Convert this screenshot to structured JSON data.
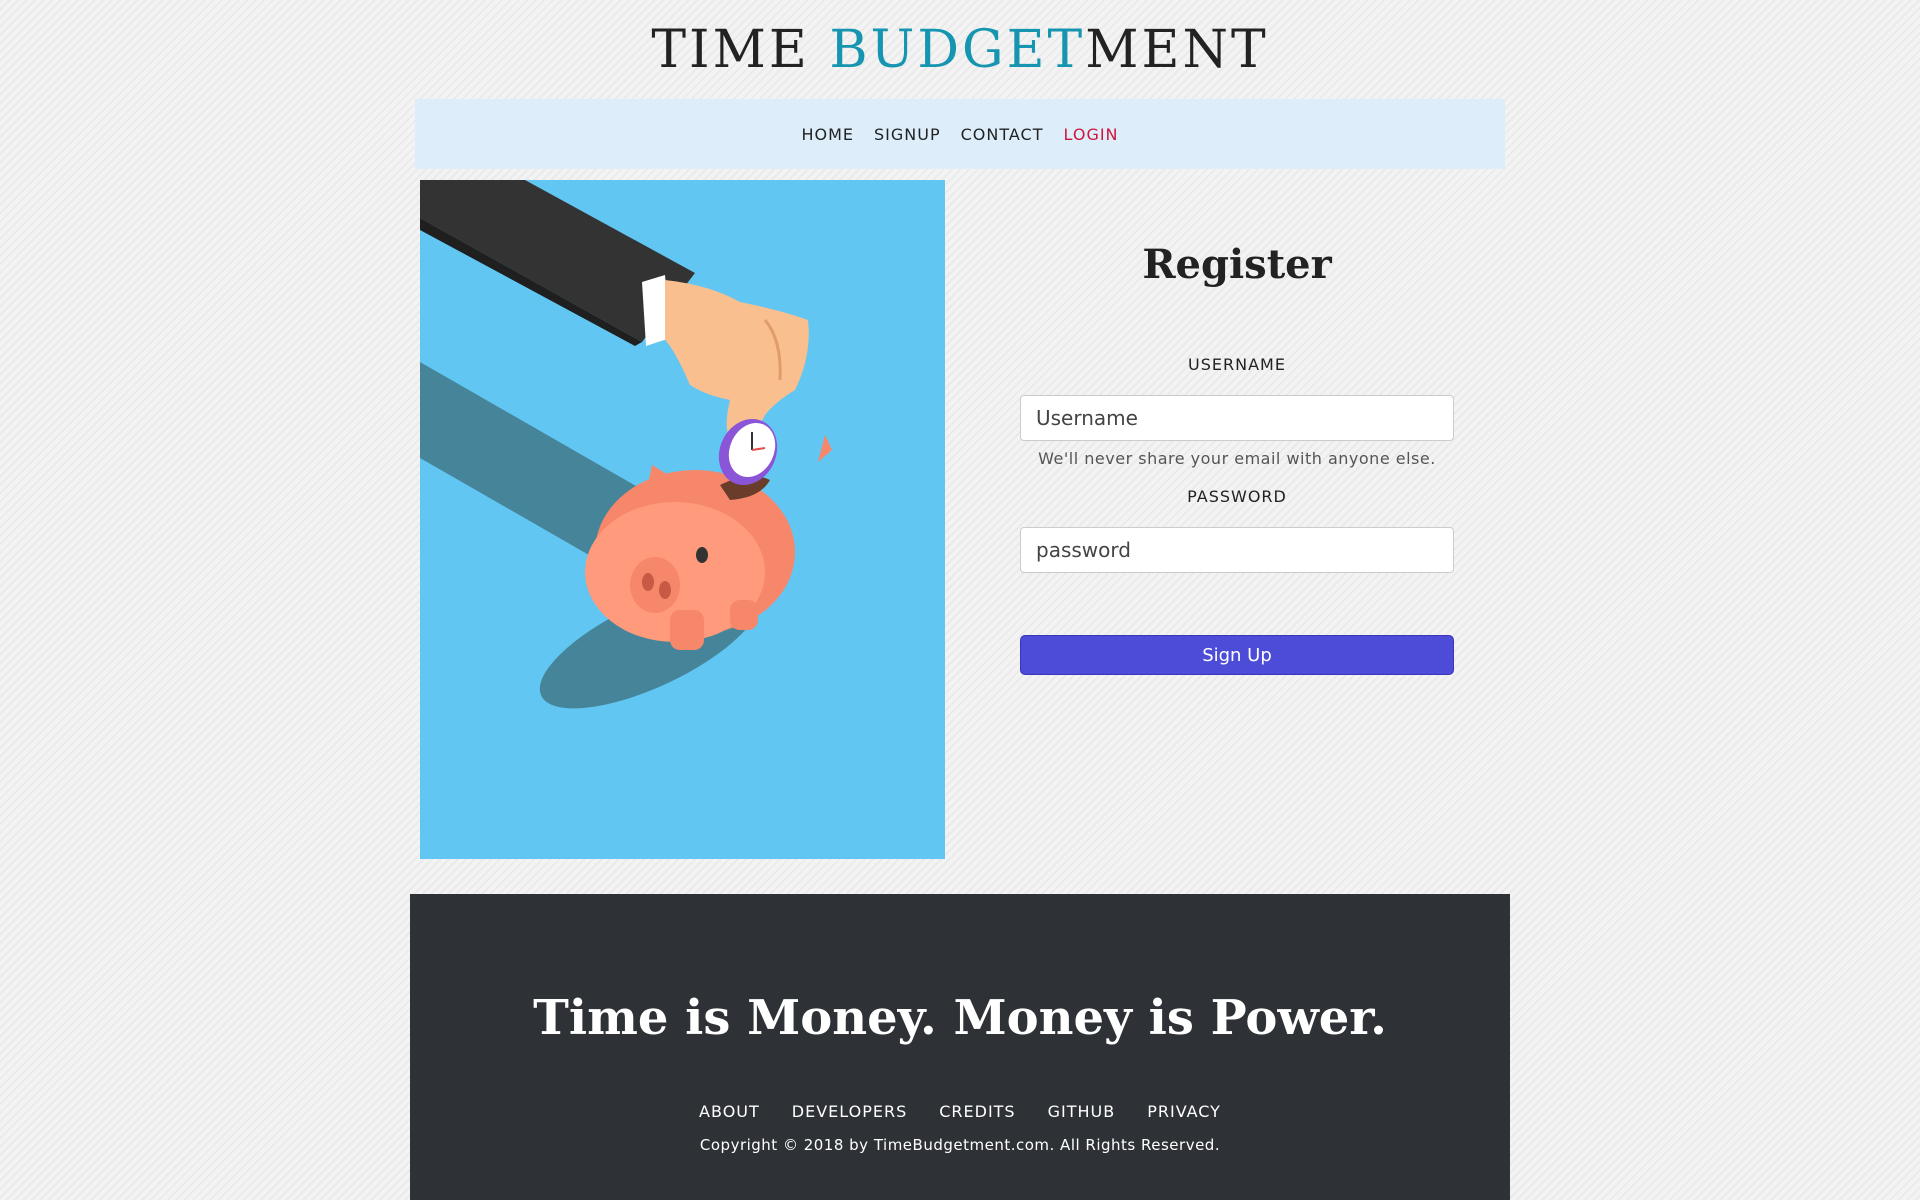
{
  "logo": {
    "part1": "TIME ",
    "part2": "BUDGET",
    "part3": "MENT"
  },
  "nav": {
    "items": [
      {
        "label": "HOME"
      },
      {
        "label": "SIGNUP"
      },
      {
        "label": "CONTACT"
      },
      {
        "label": "LOGIN",
        "active": true
      }
    ]
  },
  "form": {
    "title": "Register",
    "username_label": "USERNAME",
    "username_placeholder": "Username",
    "help_text": "We'll never share your email with anyone else.",
    "password_label": "PASSWORD",
    "password_placeholder": "password",
    "submit_label": "Sign Up"
  },
  "footer": {
    "tagline": "Time is Money. Money is Power.",
    "links": [
      {
        "label": "ABOUT"
      },
      {
        "label": "DEVELOPERS"
      },
      {
        "label": "CREDITS"
      },
      {
        "label": "GITHUB"
      },
      {
        "label": "PRIVACY"
      }
    ],
    "copyright": "Copyright © 2018 by TimeBudgetment.com. All Rights Reserved."
  },
  "colors": {
    "accent": "#1595b0",
    "nav_bg": "#ddeefa",
    "nav_active": "#d0143c",
    "hero_bg": "#62c6f3",
    "button": "#4c4cd9",
    "footer_bg": "#2e3236"
  },
  "hero_image": {
    "icon": "piggy-bank-icon"
  }
}
